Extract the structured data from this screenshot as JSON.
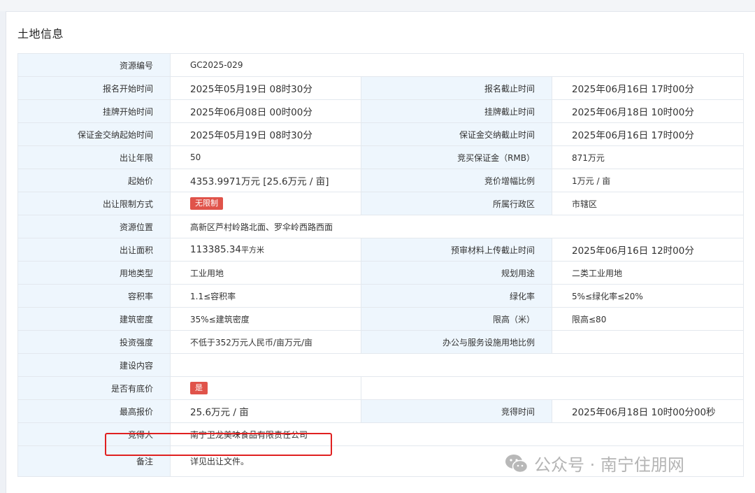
{
  "panel": {
    "title": "土地信息"
  },
  "rows": {
    "resource_no": {
      "label": "资源编号",
      "value": "GC2025-029"
    },
    "reg_start": {
      "label": "报名开始时间",
      "value": "2025年05月19日 08时30分"
    },
    "reg_end": {
      "label": "报名截止时间",
      "value": "2025年06月16日 17时00分"
    },
    "listing_start": {
      "label": "挂牌开始时间",
      "value": "2025年06月08日 00时00分"
    },
    "listing_end": {
      "label": "挂牌截止时间",
      "value": "2025年06月18日 10时00分"
    },
    "deposit_start": {
      "label": "保证金交纳起始时间",
      "value": "2025年05月19日 08时30分"
    },
    "deposit_end": {
      "label": "保证金交纳截止时间",
      "value": "2025年06月16日 17时00分"
    },
    "term": {
      "label": "出让年限",
      "value": "50"
    },
    "deposit": {
      "label": "竞买保证金（RMB）",
      "value": "871万元"
    },
    "start_price": {
      "label": "起始价",
      "value": "4353.9971万元 [25.6万元 / 亩]"
    },
    "increment": {
      "label": "竞价增幅比例",
      "value": "1万元 / 亩"
    },
    "restriction": {
      "label": "出让限制方式",
      "value": "无限制"
    },
    "district": {
      "label": "所属行政区",
      "value": "市辖区"
    },
    "location": {
      "label": "资源位置",
      "value": "高新区芦村岭路北面、罗伞岭西路西面"
    },
    "area": {
      "label": "出让面积",
      "value": "113385.34",
      "unit": "平方米"
    },
    "pre_review": {
      "label": "预审材料上传截止时间",
      "value": "2025年06月16日 12时00分"
    },
    "land_type": {
      "label": "用地类型",
      "value": "工业用地"
    },
    "planned_use": {
      "label": "规划用途",
      "value": "二类工业用地"
    },
    "far": {
      "label": "容积率",
      "value": "1.1≤容积率"
    },
    "green": {
      "label": "绿化率",
      "value": "5%≤绿化率≤20%"
    },
    "density": {
      "label": "建筑密度",
      "value": "35%≤建筑密度"
    },
    "height": {
      "label": "限高（米）",
      "value": "限高≤80"
    },
    "investment": {
      "label": "投资强度",
      "value": "不低于352万元人民币/亩万元/亩"
    },
    "office_ratio": {
      "label": "办公与服务设施用地比例",
      "value": ""
    },
    "content": {
      "label": "建设内容",
      "value": ""
    },
    "reserve": {
      "label": "是否有底价",
      "value": "是"
    },
    "top_bid": {
      "label": "最高报价",
      "value": "25.6万元 / 亩"
    },
    "win_time": {
      "label": "竞得时间",
      "value": "2025年06月18日 10时00分00秒"
    },
    "winner": {
      "label": "竞得人",
      "value": "南宁卫龙美味食品有限责任公司"
    },
    "remark": {
      "label": "备注",
      "value": "详见出让文件。"
    }
  },
  "watermark": {
    "text": "公众号 · 南宁住朋网",
    "icon": "wechat-icon"
  },
  "colors": {
    "label_bg": "#eef6fd",
    "tag_red": "#e0534a",
    "highlight": "#e02020"
  }
}
